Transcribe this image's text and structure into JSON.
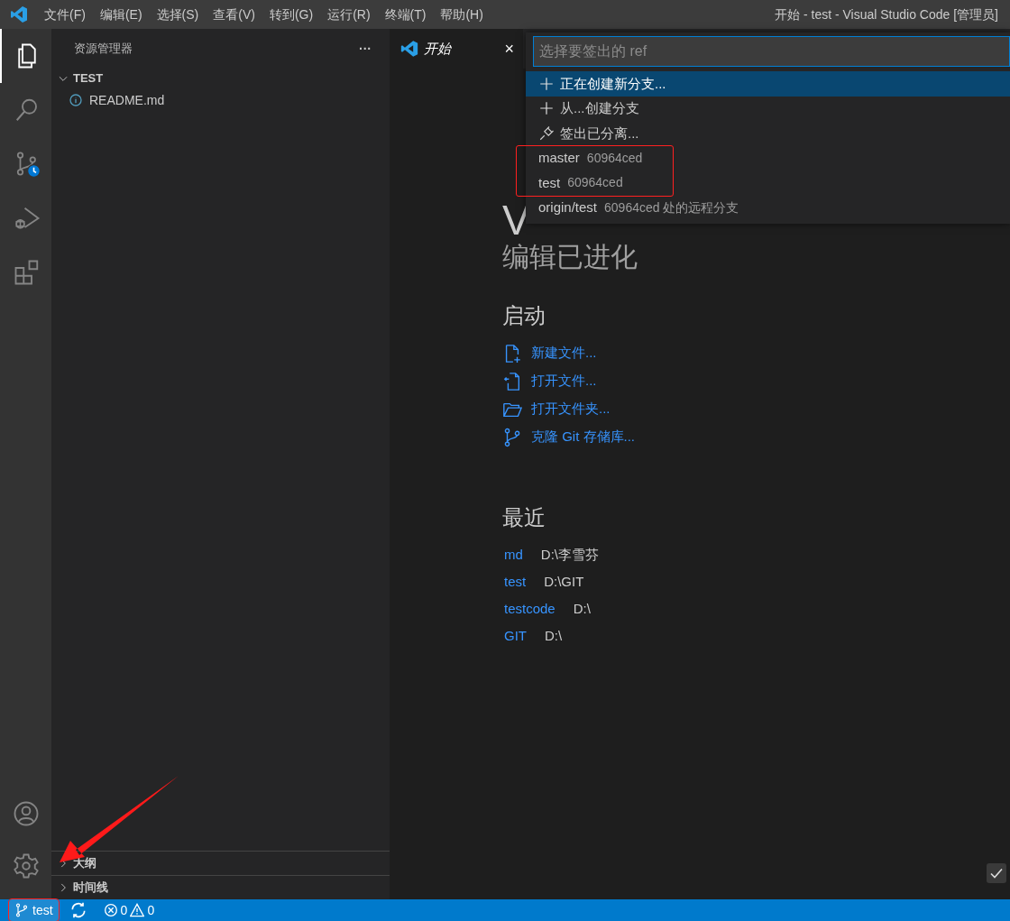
{
  "menu_bar": {
    "items": [
      "文件(F)",
      "编辑(E)",
      "选择(S)",
      "查看(V)",
      "转到(G)",
      "运行(R)",
      "终端(T)",
      "帮助(H)"
    ],
    "title": "开始 - test - Visual Studio Code [管理员]"
  },
  "activity_bar": {
    "items": [
      {
        "kind": "files",
        "selected": true
      },
      {
        "kind": "search",
        "selected": false
      },
      {
        "kind": "scm",
        "selected": false
      },
      {
        "kind": "debug",
        "selected": false
      },
      {
        "kind": "extensions",
        "selected": false
      }
    ],
    "bottom": [
      {
        "kind": "account"
      },
      {
        "kind": "settings"
      }
    ]
  },
  "sidebar": {
    "title": "资源管理器",
    "more": "···",
    "folder": {
      "label": "TEST",
      "expanded": true,
      "children": [
        {
          "label": "README.md"
        }
      ]
    },
    "panels": [
      {
        "label": "大纲",
        "expanded": false
      },
      {
        "label": "时间线",
        "expanded": false
      }
    ]
  },
  "tabs": [
    {
      "label": "开始",
      "selected": true,
      "close": "×"
    }
  ],
  "quick_pick": {
    "placeholder": "选择要签出的 ref",
    "items": [
      {
        "kind": "create",
        "label": "正在创建新分支...",
        "selected": true,
        "highlighted": false
      },
      {
        "kind": "create",
        "label": "从...创建分支",
        "selected": false,
        "highlighted": false
      },
      {
        "kind": "detach",
        "label": "签出已分离...",
        "selected": false,
        "highlighted": false
      },
      {
        "kind": "branch",
        "label": "master",
        "description": "60964ced",
        "selected": false,
        "highlighted": true
      },
      {
        "kind": "branch",
        "label": "test",
        "description": "60964ced",
        "selected": false,
        "highlighted": true
      },
      {
        "kind": "branch",
        "label": "origin/test",
        "description": "60964ced 处的远程分支",
        "selected": false,
        "highlighted": false
      }
    ]
  },
  "welcome": {
    "title": "V",
    "subtitle": "编辑已进化",
    "start": {
      "heading": "启动",
      "items": [
        {
          "kind": "new-file",
          "label": "新建文件..."
        },
        {
          "kind": "open-file",
          "label": "打开文件..."
        },
        {
          "kind": "open-folder",
          "label": "打开文件夹..."
        },
        {
          "kind": "clone",
          "label": "克隆 Git 存储库..."
        }
      ]
    },
    "recent": {
      "heading": "最近",
      "items": [
        {
          "name": "md",
          "path": "D:\\李雪芬"
        },
        {
          "name": "test",
          "path": "D:\\GIT"
        },
        {
          "name": "testcode",
          "path": "D:\\"
        },
        {
          "name": "GIT",
          "path": "D:\\"
        }
      ]
    }
  },
  "status_bar": {
    "branch": "test",
    "branch_highlighted": true,
    "errors": "0",
    "warnings": "0"
  }
}
